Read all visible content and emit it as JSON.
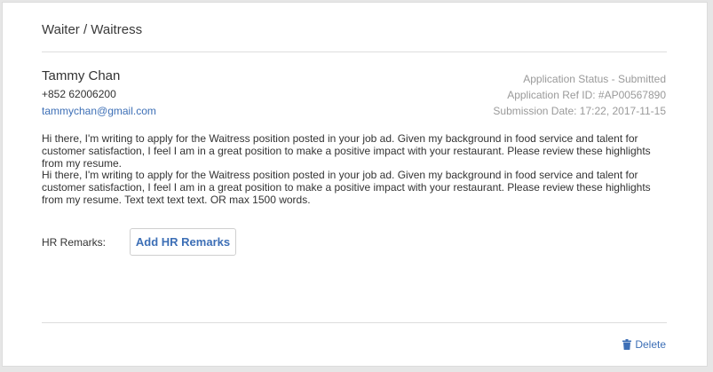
{
  "job": {
    "title": "Waiter / Waitress"
  },
  "applicant": {
    "name": "Tammy Chan",
    "phone": "+852 62006200",
    "email": "tammychan@gmail.com"
  },
  "application": {
    "status": "Application Status - Submitted",
    "ref_id": "Application Ref ID: #AP00567890",
    "submission_date": "Submission Date: 17:22, 2017-11-15"
  },
  "cover_letter": {
    "paragraphs": [
      "Hi there, I'm writing to apply for the Waitress position posted in your job ad. Given my background in food service and talent for customer satisfaction, I feel I am in a great position to make a positive impact with your restaurant. Please review these highlights from my resume.",
      "Hi there, I'm writing to apply for the Waitress position posted in your job ad. Given my background in food service and talent for customer satisfaction, I feel I am in a great position to make a positive impact with your restaurant. Please review these highlights from my resume. Text text text text. OR max 1500 words."
    ]
  },
  "hr": {
    "label": "HR Remarks:",
    "add_button": "Add HR Remarks"
  },
  "actions": {
    "delete_label": "Delete",
    "delete_icon": "trash-icon"
  },
  "colors": {
    "accent": "#3d6fb6",
    "text": "#333333",
    "muted": "#9a9a9a"
  }
}
